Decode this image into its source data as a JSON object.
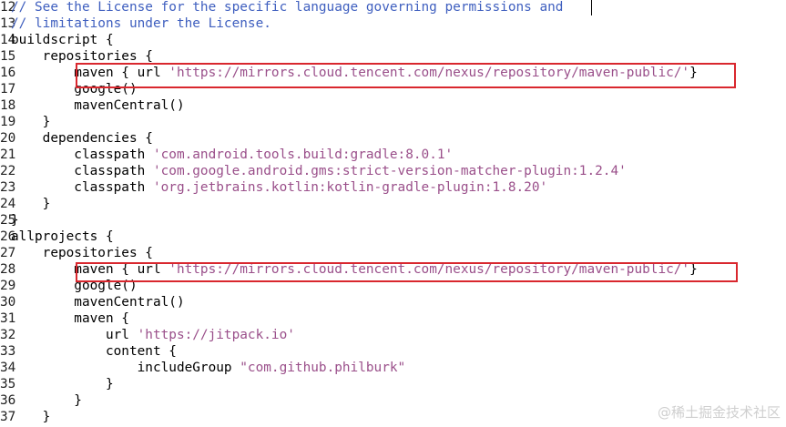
{
  "colors": {
    "comment": "#3f5fbf",
    "string": "#9a4f8a",
    "text": "#000000",
    "highlight_box": "#d9272e",
    "watermark": "#cfcfcf"
  },
  "lines": [
    {
      "num": "12",
      "segs": [
        {
          "t": "// See the License for the specific language governing permissions and",
          "c": "comment"
        }
      ]
    },
    {
      "num": "13",
      "segs": [
        {
          "t": "// limitations under the License.",
          "c": "comment"
        }
      ]
    },
    {
      "num": "14",
      "segs": [
        {
          "t": "buildscript {",
          "c": ""
        }
      ]
    },
    {
      "num": "15",
      "segs": [
        {
          "t": "    repositories {",
          "c": ""
        }
      ]
    },
    {
      "num": "16",
      "segs": [
        {
          "t": "        maven { url ",
          "c": ""
        },
        {
          "t": "'https://mirrors.cloud.tencent.com/nexus/repository/maven-public/'",
          "c": "str"
        },
        {
          "t": "}",
          "c": ""
        }
      ]
    },
    {
      "num": "17",
      "segs": [
        {
          "t": "        google()",
          "c": ""
        }
      ]
    },
    {
      "num": "18",
      "segs": [
        {
          "t": "        mavenCentral()",
          "c": ""
        }
      ]
    },
    {
      "num": "19",
      "segs": [
        {
          "t": "    }",
          "c": ""
        }
      ]
    },
    {
      "num": "20",
      "segs": [
        {
          "t": "    dependencies {",
          "c": ""
        }
      ]
    },
    {
      "num": "21",
      "segs": [
        {
          "t": "        classpath ",
          "c": ""
        },
        {
          "t": "'com.android.tools.build:gradle:8.0.1'",
          "c": "str"
        }
      ]
    },
    {
      "num": "22",
      "segs": [
        {
          "t": "        classpath ",
          "c": ""
        },
        {
          "t": "'com.google.android.gms:strict-version-matcher-plugin:1.2.4'",
          "c": "str"
        }
      ]
    },
    {
      "num": "23",
      "segs": [
        {
          "t": "        classpath ",
          "c": ""
        },
        {
          "t": "'org.jetbrains.kotlin:kotlin-gradle-plugin:1.8.20'",
          "c": "str"
        }
      ]
    },
    {
      "num": "24",
      "segs": [
        {
          "t": "    }",
          "c": ""
        }
      ]
    },
    {
      "num": "25",
      "segs": [
        {
          "t": "}",
          "c": ""
        }
      ]
    },
    {
      "num": "26",
      "segs": [
        {
          "t": "allprojects {",
          "c": ""
        }
      ]
    },
    {
      "num": "27",
      "segs": [
        {
          "t": "    repositories {",
          "c": ""
        }
      ]
    },
    {
      "num": "28",
      "segs": [
        {
          "t": "        maven { url ",
          "c": ""
        },
        {
          "t": "'https://mirrors.cloud.tencent.com/nexus/repository/maven-public/'",
          "c": "str"
        },
        {
          "t": "}",
          "c": ""
        }
      ]
    },
    {
      "num": "29",
      "segs": [
        {
          "t": "        google()",
          "c": ""
        }
      ]
    },
    {
      "num": "30",
      "segs": [
        {
          "t": "        mavenCentral()",
          "c": ""
        }
      ]
    },
    {
      "num": "31",
      "segs": [
        {
          "t": "        maven {",
          "c": ""
        }
      ]
    },
    {
      "num": "32",
      "segs": [
        {
          "t": "            url ",
          "c": ""
        },
        {
          "t": "'https://jitpack.io'",
          "c": "str"
        }
      ]
    },
    {
      "num": "33",
      "segs": [
        {
          "t": "            content {",
          "c": ""
        }
      ]
    },
    {
      "num": "34",
      "segs": [
        {
          "t": "                includeGroup ",
          "c": ""
        },
        {
          "t": "\"com.github.philburk\"",
          "c": "str"
        }
      ]
    },
    {
      "num": "35",
      "segs": [
        {
          "t": "            }",
          "c": ""
        }
      ]
    },
    {
      "num": "36",
      "segs": [
        {
          "t": "        }",
          "c": ""
        }
      ]
    },
    {
      "num": "37",
      "segs": [
        {
          "t": "    }",
          "c": ""
        }
      ]
    }
  ],
  "watermark": "@稀土掘金技术社区"
}
